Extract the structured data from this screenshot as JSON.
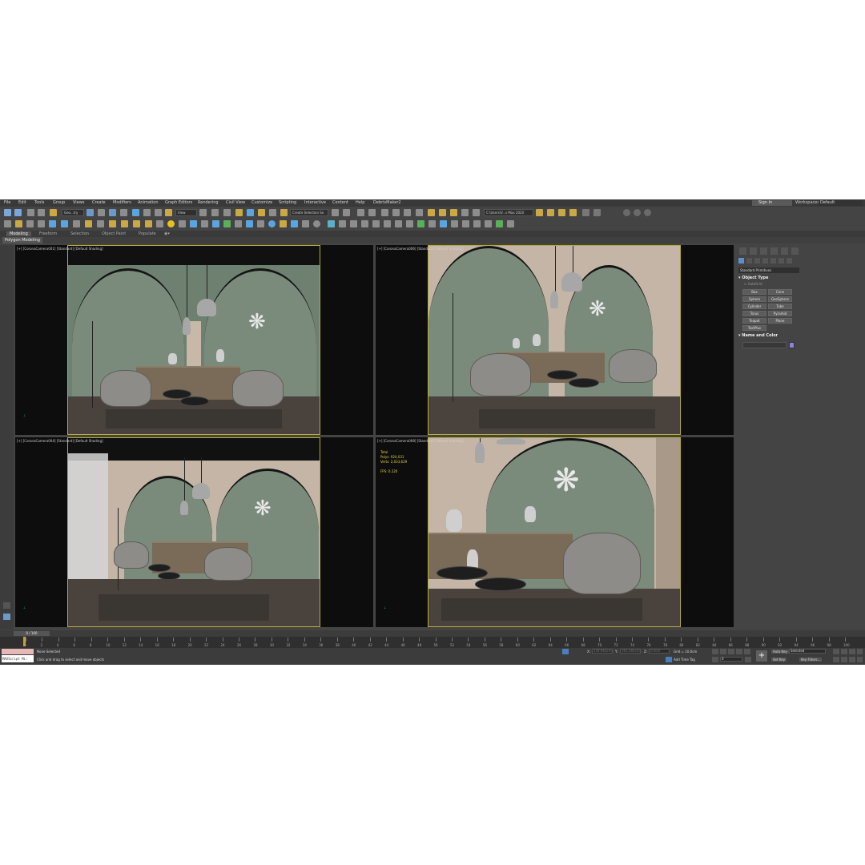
{
  "menu": [
    "File",
    "Edit",
    "Tools",
    "Group",
    "Views",
    "Create",
    "Modifiers",
    "Animation",
    "Graph Editors",
    "Rendering",
    "Civil View",
    "Customize",
    "Scripting",
    "Interactive",
    "Content",
    "Help",
    "DebrisMaker2"
  ],
  "account": {
    "sign_in": "Sign In",
    "workspaces_label": "Workspaces:",
    "workspace": "Default"
  },
  "toolbar": {
    "selection_filter": "Geo...try",
    "view_dropdown": "View",
    "named_selection": "Create Selection Se",
    "project_path": "C:\\Users\\V...s Max 2020"
  },
  "ribbon": {
    "tabs": [
      "Modeling",
      "Freeform",
      "Selection",
      "Object Paint",
      "Populate"
    ],
    "active_tab": "Modeling",
    "sub_label": "Polygon Modeling"
  },
  "viewports": [
    {
      "label": "[+] [CoronaCamera001] [Standard] [Default Shading]"
    },
    {
      "label": "[+] [CoronaCamera006] [Standard] [Default Shading]"
    },
    {
      "label": "[+] [CoronaCamera004] [Standard] [Default Shading]"
    },
    {
      "label": "[+] [CoronaCamera008] [Standard] [Default Shading]"
    }
  ],
  "stats": {
    "total": "Total",
    "polys_label": "Polys:",
    "polys": "924,031",
    "verts_label": "Verts:",
    "verts": "2,033,629",
    "fps_label": "FPS:",
    "fps": "0.220"
  },
  "command_panel": {
    "category": "Standard Primitives",
    "object_type_title": "Object Type",
    "autogrid": "AutoGrid",
    "primitives": [
      "Box",
      "Cone",
      "Sphere",
      "GeoSphere",
      "Cylinder",
      "Tube",
      "Torus",
      "Pyramid",
      "Teapot",
      "Plane",
      "TextPlus"
    ],
    "name_color_title": "Name and Color",
    "object_color": "#8c83e0"
  },
  "timeline": {
    "frame_counter": "0 / 100",
    "ticks": [
      "0",
      "2",
      "4",
      "6",
      "8",
      "10",
      "12",
      "14",
      "16",
      "18",
      "20",
      "22",
      "24",
      "26",
      "28",
      "30",
      "32",
      "34",
      "36",
      "38",
      "40",
      "42",
      "44",
      "46",
      "48",
      "50",
      "52",
      "54",
      "56",
      "58",
      "60",
      "62",
      "64",
      "66",
      "68",
      "70",
      "72",
      "74",
      "76",
      "78",
      "80",
      "82",
      "84",
      "86",
      "88",
      "90",
      "92",
      "94",
      "96",
      "98",
      "100"
    ]
  },
  "status": {
    "maxscript": "MAXScript Mi:",
    "selection": "None Selected",
    "prompt": "Click and drag to select and move objects",
    "x_label": "X:",
    "x_value": "144.963cm",
    "y_label": "Y:",
    "y_value": "165.281cm",
    "z_label": "Z:",
    "z_value": "0.0cm",
    "grid": "Grid = 10.0cm",
    "add_time_tag": "Add Time Tag",
    "auto_key": "Auto Key",
    "set_key": "Set Key",
    "key_mode": "Selected",
    "key_filters": "Key Filters...",
    "frame": "0"
  }
}
